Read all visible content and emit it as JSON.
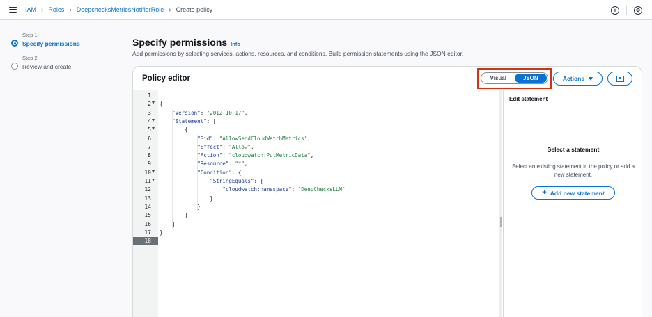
{
  "breadcrumb": {
    "items": [
      "IAM",
      "Roles",
      "DeepchecksMetricsNotifierRole"
    ],
    "current": "Create policy"
  },
  "icons": {
    "menu": "hamburger-menu-icon",
    "info": "info-circle-icon",
    "settings": "settings-gear-icon",
    "info_glyph": "i",
    "settings_glyph": "⚙"
  },
  "steps": [
    {
      "number": "Step 1",
      "title": "Specify permissions",
      "active": true
    },
    {
      "number": "Step 2",
      "title": "Review and create",
      "active": false
    }
  ],
  "page": {
    "title": "Specify permissions",
    "info_label": "Info",
    "description": "Add permissions by selecting services, actions, resources, and conditions. Build permission statements using the JSON editor."
  },
  "editor": {
    "title": "Policy editor",
    "mode_options": [
      "Visual",
      "JSON"
    ],
    "selected_mode": "JSON",
    "actions_label": "Actions",
    "highlight_color": "#d13212",
    "accent_color": "#0972d3",
    "current_line": 18,
    "foldable_lines": [
      2,
      4,
      5,
      10,
      11
    ],
    "lines": [
      "",
      "{",
      "    \"Version\": \"2012-10-17\",",
      "    \"Statement\": [",
      "        {",
      "            \"Sid\": \"AllowSendCloudWatchMetrics\",",
      "            \"Effect\": \"Allow\",",
      "            \"Action\": \"cloudwatch:PutMetricData\",",
      "            \"Resource\": \"*\",",
      "            \"Condition\": {",
      "                \"StringEquals\": {",
      "                    \"cloudwatch:namespace\": \"DeepChecksLLM\"",
      "                }",
      "            }",
      "        }",
      "    ]",
      "}",
      ""
    ]
  },
  "statement_panel": {
    "header": "Edit statement",
    "title": "Select a statement",
    "text": "Select an existing statement in the policy or add a new statement.",
    "add_label": "Add new statement"
  }
}
